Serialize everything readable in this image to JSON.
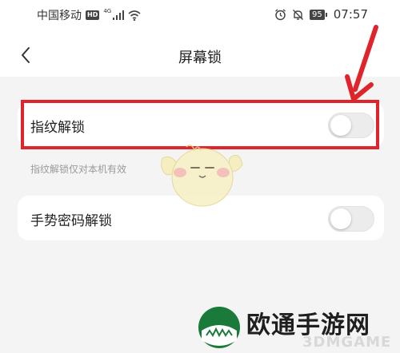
{
  "status_bar": {
    "carrier": "中国移动",
    "hd_badge": "HD",
    "network_type": "4G",
    "battery": "95",
    "time": "07:57",
    "icons": [
      "signal-icon",
      "wifi-icon",
      "alarm-icon",
      "mute-icon"
    ]
  },
  "nav": {
    "back_icon": "chevron-left-icon",
    "title": "屏幕锁"
  },
  "settings": {
    "fingerprint_label": "指纹解锁",
    "fingerprint_enabled": false,
    "fingerprint_hint": "指纹解锁仅对本机有效",
    "gesture_label": "手势密码解锁",
    "gesture_enabled": false
  },
  "annotation": {
    "highlight_color": "#e0242c"
  },
  "watermark": {
    "text_cn": "欧通手游网",
    "text_en": "3DMGAME"
  }
}
